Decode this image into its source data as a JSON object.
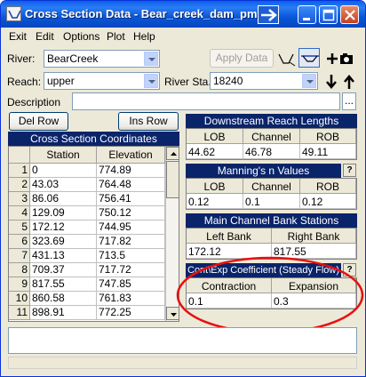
{
  "window": {
    "title": "Cross Section Data - Bear_creek_dam_pm"
  },
  "menu": [
    "Exit",
    "Edit",
    "Options",
    "Plot",
    "Help"
  ],
  "river": {
    "label": "River:",
    "value": "BearCreek"
  },
  "reach": {
    "label": "Reach:",
    "value": "upper"
  },
  "river_sta": {
    "label": "River Sta.:",
    "value": "18240"
  },
  "apply_data": "Apply Data",
  "description": {
    "label": "Description",
    "value": "",
    "ellipsis": "..."
  },
  "buttons": {
    "del_row": "Del Row",
    "ins_row": "Ins Row"
  },
  "xs_coords": {
    "title": "Cross Section Coordinates",
    "columns": [
      "Station",
      "Elevation"
    ],
    "rows": [
      [
        "1",
        "0",
        "774.89"
      ],
      [
        "2",
        "43.03",
        "764.48"
      ],
      [
        "3",
        "86.06",
        "756.41"
      ],
      [
        "4",
        "129.09",
        "750.12"
      ],
      [
        "5",
        "172.12",
        "744.95"
      ],
      [
        "6",
        "323.69",
        "717.82"
      ],
      [
        "7",
        "431.13",
        "713.5"
      ],
      [
        "8",
        "709.37",
        "717.72"
      ],
      [
        "9",
        "817.55",
        "747.85"
      ],
      [
        "10",
        "860.58",
        "761.83"
      ],
      [
        "11",
        "898.91",
        "772.25"
      ]
    ]
  },
  "downstream": {
    "title": "Downstream Reach Lengths",
    "columns": [
      "LOB",
      "Channel",
      "ROB"
    ],
    "values": [
      "44.62",
      "46.78",
      "49.11"
    ]
  },
  "mannings": {
    "title": "Manning's n Values",
    "help": "?",
    "columns": [
      "LOB",
      "Channel",
      "ROB"
    ],
    "values": [
      "0.12",
      "0.1",
      "0.12"
    ]
  },
  "bank_stations": {
    "title": "Main Channel Bank Stations",
    "columns": [
      "Left Bank",
      "Right Bank"
    ],
    "values": [
      "172.12",
      "817.55"
    ]
  },
  "coefficients": {
    "title": "Cont\\Exp Coefficient (Steady Flow)",
    "help": "?",
    "columns": [
      "Contraction",
      "Expansion"
    ],
    "values": [
      "0.1",
      "0.3"
    ]
  },
  "colors": {
    "title_bar": "#0a5fe8",
    "panel_header": "#0a246a",
    "window_bg": "#ece9d8",
    "highlight_ellipse": "#e81010"
  }
}
